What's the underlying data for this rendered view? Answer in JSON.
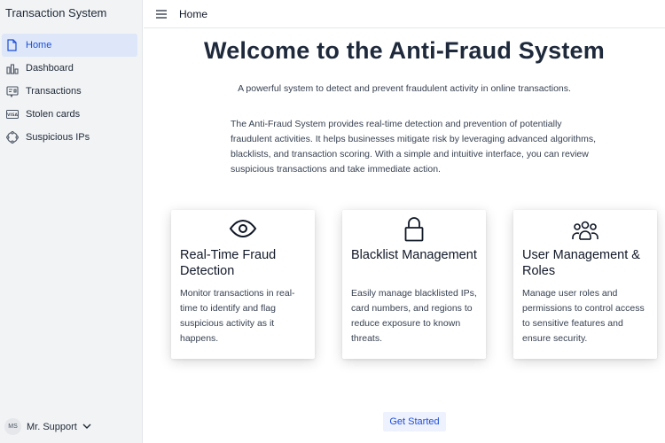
{
  "app": {
    "title": "Transaction System"
  },
  "sidebar": {
    "items": [
      {
        "label": "Home",
        "icon": "document-icon",
        "active": true
      },
      {
        "label": "Dashboard",
        "icon": "bar-chart-icon"
      },
      {
        "label": "Transactions",
        "icon": "receipt-icon"
      },
      {
        "label": "Stolen cards",
        "icon": "visa-card-icon"
      },
      {
        "label": "Suspicious IPs",
        "icon": "globe-icon"
      }
    ],
    "user": {
      "initials": "MS",
      "name": "Mr. Support"
    }
  },
  "header": {
    "breadcrumb": "Home"
  },
  "main": {
    "title": "Welcome to the Anti-Fraud System",
    "subtitle": "A powerful system to detect and prevent fraudulent activity in online transactions.",
    "description": "The Anti-Fraud System provides real-time detection and prevention of potentially fraudulent activities. It helps businesses mitigate risk by leveraging advanced algorithms, blacklists, and transaction scoring. With a simple and intuitive interface, you can review suspicious transactions and take immediate action.",
    "cards": [
      {
        "icon": "eye-icon",
        "title": "Real-Time Fraud Detection",
        "text": "Monitor transactions in real-time to identify and flag suspicious activity as it happens."
      },
      {
        "icon": "lock-icon",
        "title": "Blacklist Management",
        "text": "Easily manage blacklisted IPs, card numbers, and regions to reduce exposure to known threats."
      },
      {
        "icon": "users-icon",
        "title": "User Management & Roles",
        "text": "Manage user roles and permissions to control access to sensitive features and ensure security."
      }
    ],
    "cta_label": "Get Started"
  },
  "colors": {
    "accent": "#1d4ed8",
    "active_bg": "#dde7f9",
    "sidebar_bg": "#f1f3f5"
  }
}
